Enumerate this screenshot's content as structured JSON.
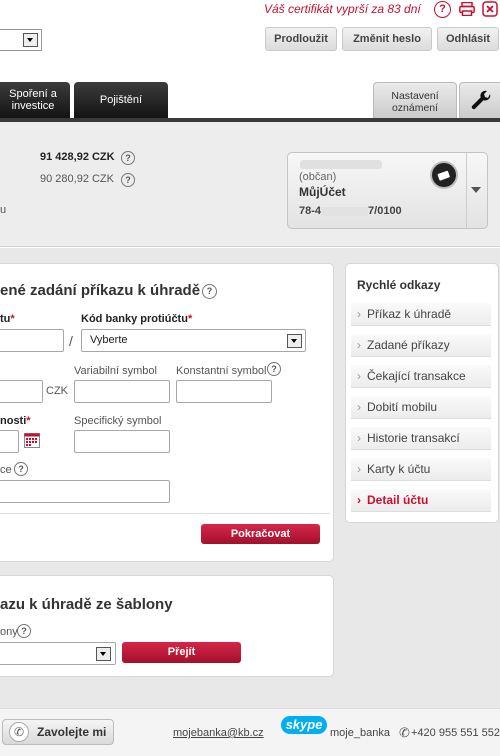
{
  "header": {
    "certificate_notice": "Váš certifikát vyprší za 83 dní",
    "help_icon": "?",
    "extend_button": "Prodloužit",
    "change_password_button": "Změnit heslo",
    "logout_button": "Odhlásit"
  },
  "tabs": {
    "savings": "Spoření a investice",
    "insurance": "Pojištění",
    "notifications": "Nastavení oznámení"
  },
  "account_summary": {
    "available_balance": "91 428,92 CZK",
    "account_balance": "90 280,92 CZK",
    "partial_label": "u"
  },
  "account_card": {
    "owner_type": "(občan)",
    "product": "MůjÚčet",
    "number_prefix": "78-4",
    "number_suffix": "7/0100"
  },
  "payment_form": {
    "title": "ené zadání příkazu k úhradě",
    "account_label": "tu",
    "account_required": "*",
    "bank_code_label": "Kód banky protiúčtu",
    "bank_code_required": "*",
    "bank_code_value": "Vyberte",
    "slash": "/",
    "currency": "CZK",
    "variable_symbol": "Variabilní symbol",
    "constant_symbol": "Konstantní symbol",
    "due_date_label": "nosti",
    "due_date_required": "*",
    "specific_symbol": "Specifický symbol",
    "message_label": "ce",
    "continue_button": "Pokračovat"
  },
  "template_form": {
    "title": "azu k úhradě ze šablony",
    "template_label": "ony",
    "go_button": "Přejít"
  },
  "quick_links": {
    "title": "Rychlé odkazy",
    "items": [
      {
        "label": "Příkaz k úhradě"
      },
      {
        "label": "Zadané příkazy"
      },
      {
        "label": "Čekající transakce"
      },
      {
        "label": "Dobití mobilu"
      },
      {
        "label": "Historie transakcí"
      },
      {
        "label": "Karty k účtu"
      },
      {
        "label": "Detail účtu"
      }
    ]
  },
  "footer": {
    "call_us": "Zavolejte mi",
    "email": "mojebanka@kb.cz",
    "skype_logo": "skype",
    "skype_name": "moje_banka",
    "phone": "+420 955 551 552"
  },
  "colors": {
    "brand_red": "#c8102e",
    "dark_tab": "#1f1f1f"
  }
}
